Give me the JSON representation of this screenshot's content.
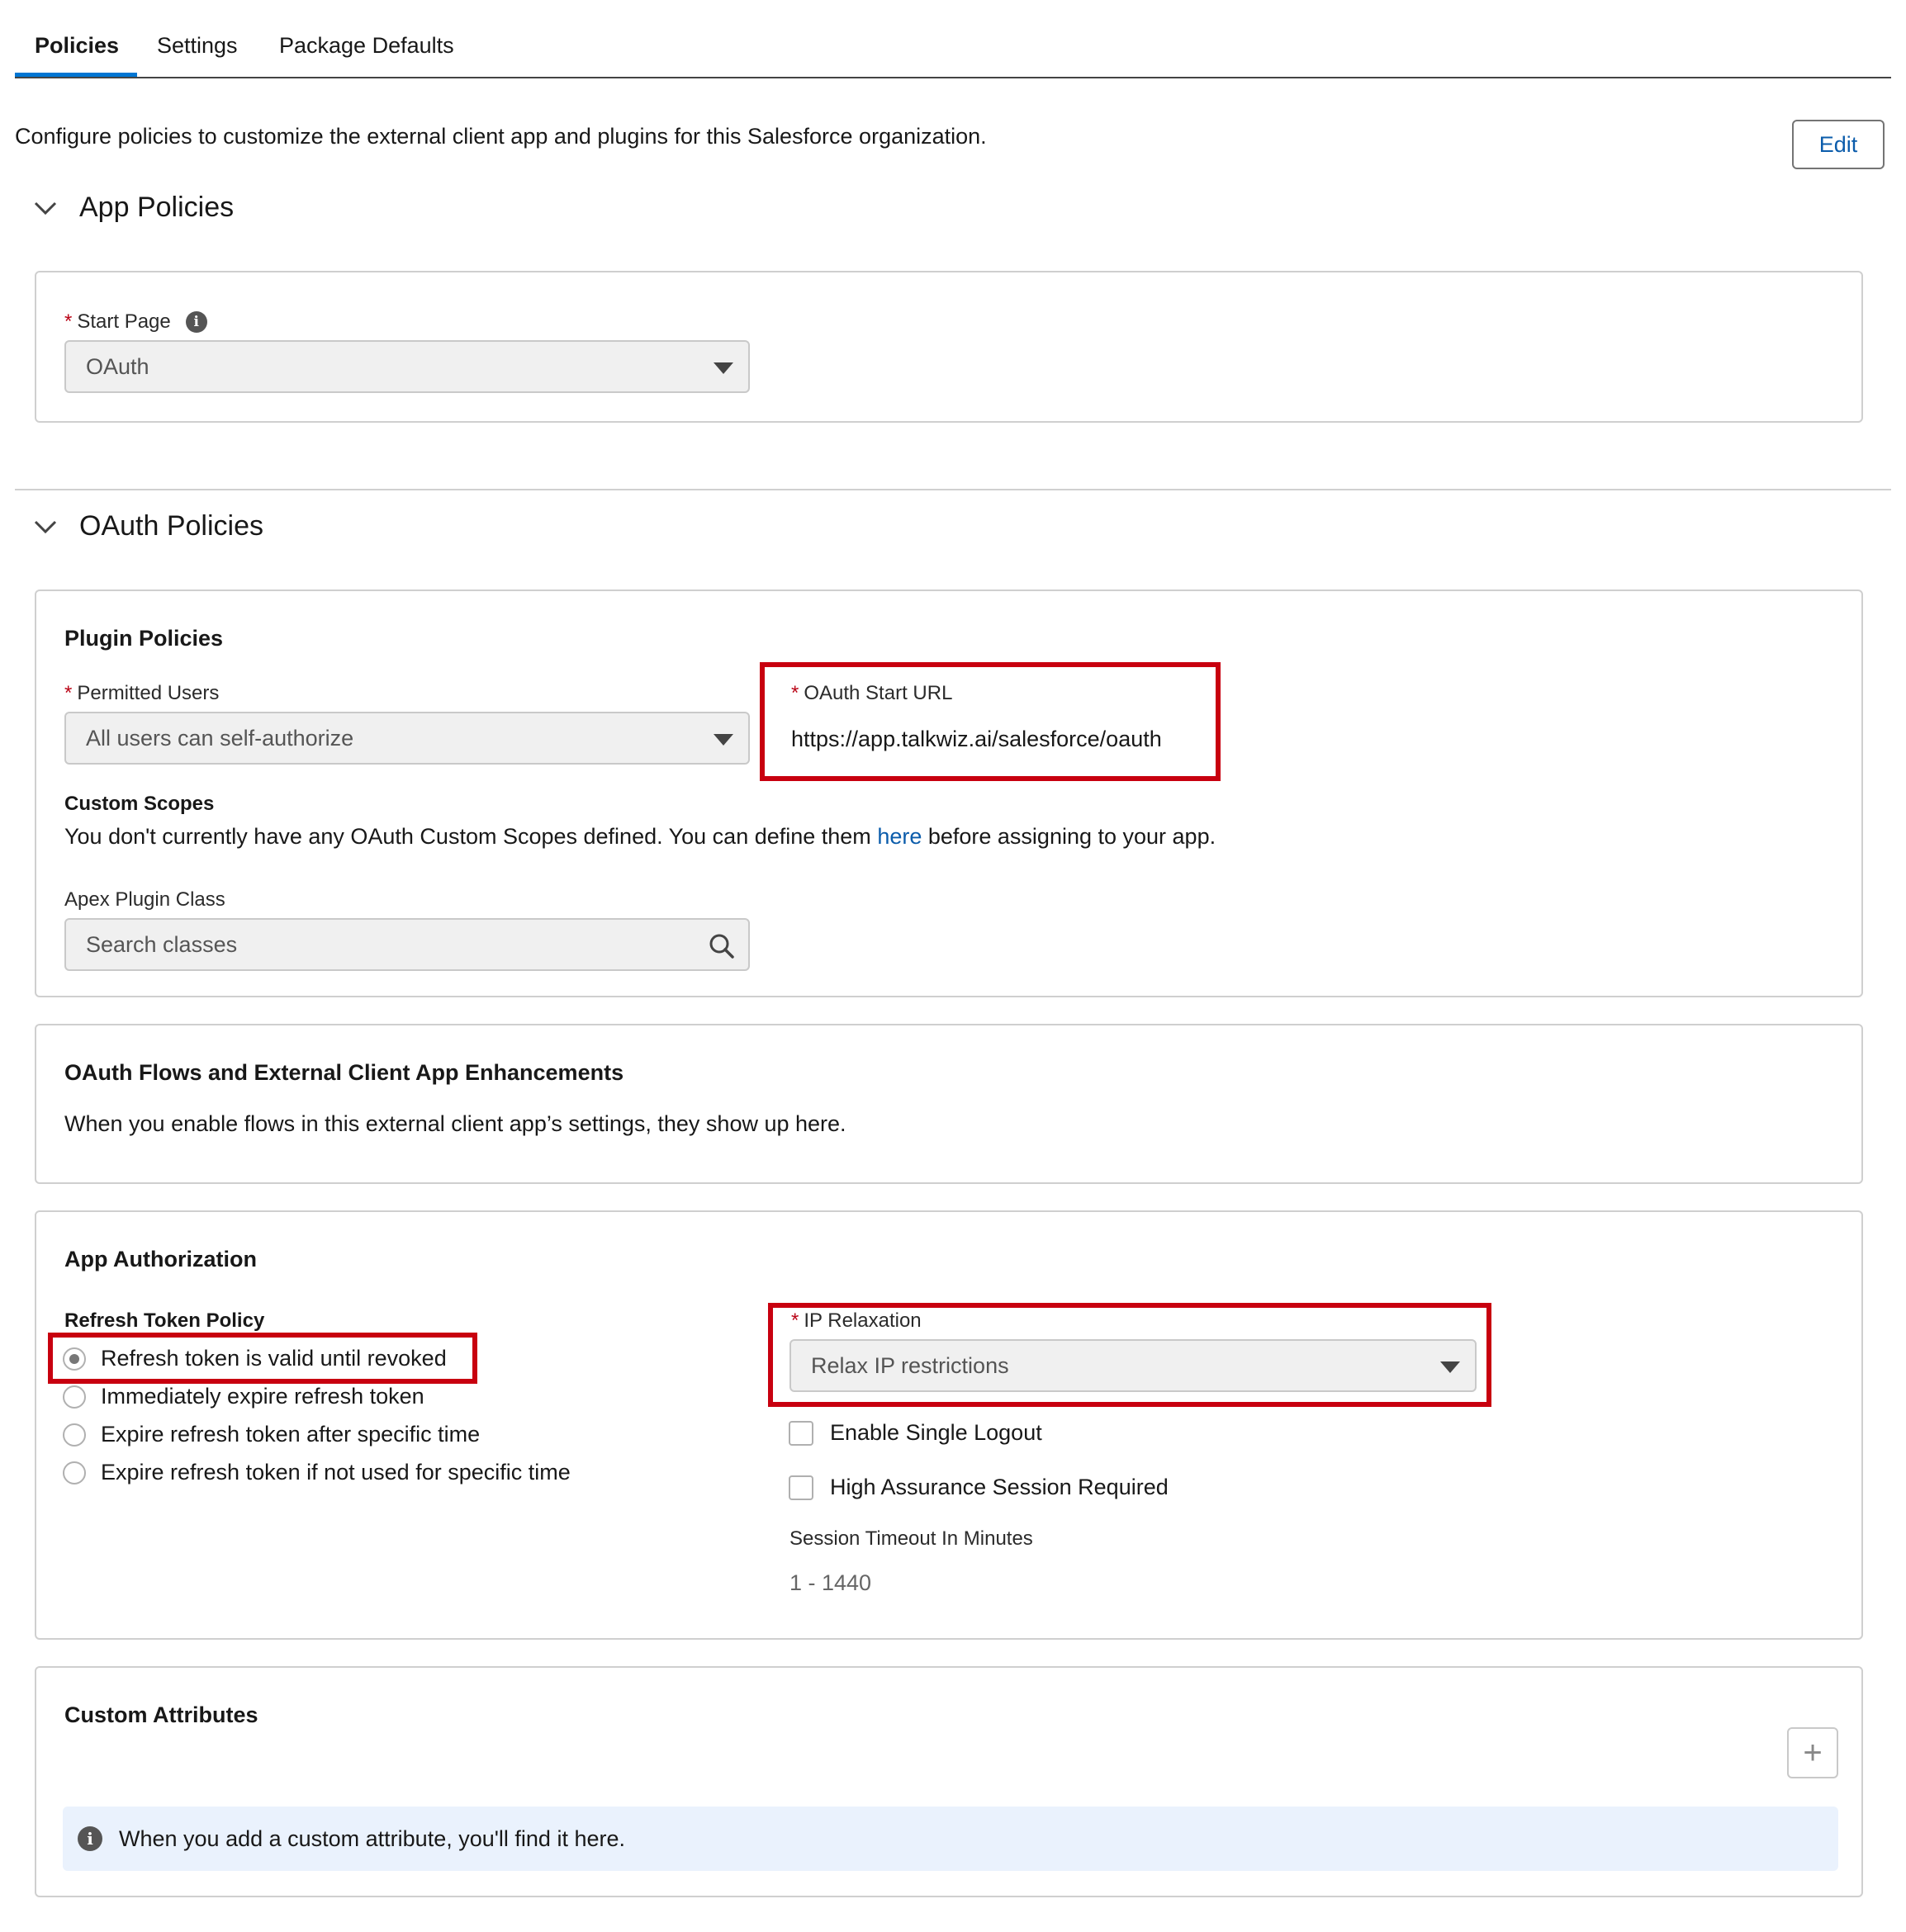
{
  "tabs": [
    {
      "label": "Policies",
      "active": true
    },
    {
      "label": "Settings",
      "active": false
    },
    {
      "label": "Package Defaults",
      "active": false
    }
  ],
  "description": "Configure policies to customize the external client app and plugins for this Salesforce organization.",
  "edit_label": "Edit",
  "app_policies": {
    "title": "App Policies",
    "start_page_label": "Start Page",
    "start_page_value": "OAuth"
  },
  "oauth_policies": {
    "title": "OAuth Policies",
    "plugin": {
      "title": "Plugin Policies",
      "permitted_users_label": "Permitted Users",
      "permitted_users_value": "All users can self-authorize",
      "oauth_start_url_label": "OAuth Start URL",
      "oauth_start_url_value": "https://app.talkwiz.ai/salesforce/oauth",
      "custom_scopes_title": "Custom Scopes",
      "custom_scopes_text_before": "You don't currently have any OAuth Custom Scopes defined. You can define them ",
      "custom_scopes_link": "here",
      "custom_scopes_text_after": " before assigning to your app.",
      "apex_label": "Apex Plugin Class",
      "apex_placeholder": "Search classes"
    },
    "flows": {
      "title": "OAuth Flows and External Client App Enhancements",
      "text": "When you enable flows in this external client app’s settings, they show up here."
    },
    "authorization": {
      "title": "App Authorization",
      "refresh_policy_label": "Refresh Token Policy",
      "refresh_options": [
        {
          "label": "Refresh token is valid until revoked",
          "checked": true
        },
        {
          "label": "Immediately expire refresh token",
          "checked": false
        },
        {
          "label": "Expire refresh token after specific time",
          "checked": false
        },
        {
          "label": "Expire refresh token if not used for specific time",
          "checked": false
        }
      ],
      "ip_label": "IP Relaxation",
      "ip_value": "Relax IP restrictions",
      "single_logout_label": "Enable Single Logout",
      "high_assurance_label": "High Assurance Session Required",
      "session_timeout_label": "Session Timeout In Minutes",
      "session_timeout_placeholder": "1 - 1440"
    },
    "custom_attributes": {
      "title": "Custom Attributes",
      "add_label": "+",
      "empty_text": "When you add a custom attribute, you'll find it here."
    }
  },
  "colors": {
    "accent": "#0176d3",
    "link": "#0b5cab",
    "required": "#ba0517",
    "highlight": "#c8000f"
  }
}
